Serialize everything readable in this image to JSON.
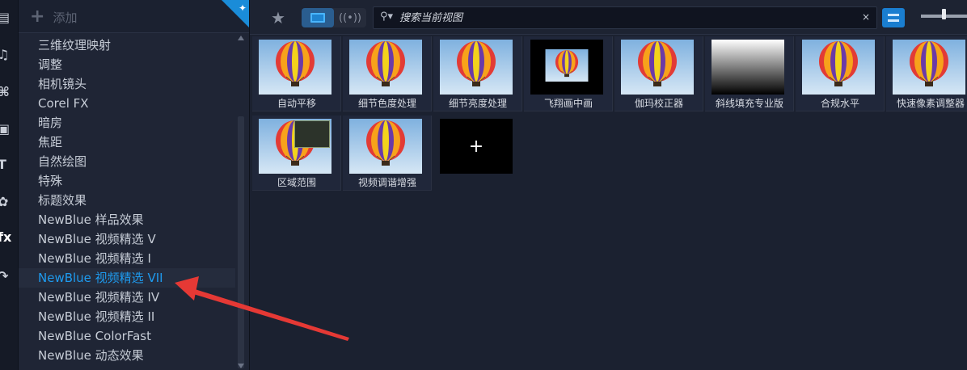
{
  "panel": {
    "add_label": "添加",
    "categories": [
      "三维纹理映射",
      "调整",
      "相机镜头",
      "Corel FX",
      "暗房",
      "焦距",
      "自然绘图",
      "特殊",
      "标题效果",
      "NewBlue 样品效果",
      "NewBlue 视频精选 V",
      "NewBlue 视频精选 I",
      "NewBlue 视频精选 VII",
      "NewBlue 视频精选 IV",
      "NewBlue 视频精选 II",
      "NewBlue ColorFast",
      "NewBlue 动态效果"
    ],
    "selected_category": "NewBlue 视频精选 VII"
  },
  "rail": {
    "icons": [
      "media-icon",
      "music-icon",
      "transition-icon",
      "overlay-icon",
      "title-icon",
      "graphics-icon",
      "fx-icon",
      "motion-icon"
    ],
    "active": "fx-icon"
  },
  "toolbar": {
    "search_placeholder": "搜索当前视图",
    "clear_symbol": "×"
  },
  "effects": [
    {
      "label": "自动平移",
      "thumb": "balloon"
    },
    {
      "label": "细节色度处理",
      "thumb": "balloon"
    },
    {
      "label": "细节亮度处理",
      "thumb": "balloon"
    },
    {
      "label": "飞翔画中画",
      "thumb": "pip"
    },
    {
      "label": "伽玛校正器",
      "thumb": "balloon"
    },
    {
      "label": "斜线填充专业版",
      "thumb": "gradient"
    },
    {
      "label": "合规水平",
      "thumb": "balloon"
    },
    {
      "label": "快速像素调整器",
      "thumb": "balloon"
    },
    {
      "label": "区域范围",
      "thumb": "region"
    },
    {
      "label": "视频调谐增强",
      "thumb": "balloon"
    }
  ],
  "add_tile_symbol": "+",
  "colors": {
    "accent": "#1e9bef",
    "arrow": "#e53935"
  }
}
